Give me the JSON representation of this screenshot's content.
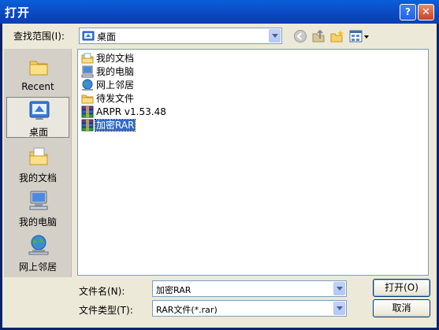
{
  "window": {
    "title": "打开",
    "help_label": "?",
    "close_label": "✕"
  },
  "toolbar": {
    "lookin_label": "查找范围(I):",
    "lookin_value": "桌面",
    "back_icon": "back-icon",
    "up_icon": "up-folder-icon",
    "newfolder_icon": "new-folder-icon",
    "views_icon": "views-menu-icon"
  },
  "places": [
    {
      "label": "Recent",
      "icon": "recent-icon"
    },
    {
      "label": "桌面",
      "icon": "desktop-icon",
      "selected": true
    },
    {
      "label": "我的文档",
      "icon": "my-documents-icon"
    },
    {
      "label": "我的电脑",
      "icon": "my-computer-icon"
    },
    {
      "label": "网上邻居",
      "icon": "network-icon"
    }
  ],
  "files": [
    {
      "label": "我的文档",
      "icon": "documents-folder-icon"
    },
    {
      "label": "我的电脑",
      "icon": "computer-icon"
    },
    {
      "label": "网上邻居",
      "icon": "network-icon"
    },
    {
      "label": "待发文件",
      "icon": "folder-icon"
    },
    {
      "label": "ARPR v1.53.48",
      "icon": "rar-archive-icon"
    },
    {
      "label": "加密RAR",
      "icon": "rar-archive-icon",
      "selected": true
    }
  ],
  "bottom": {
    "filename_label": "文件名(N):",
    "filename_value": "加密RAR",
    "filetype_label": "文件类型(T):",
    "filetype_value": "RAR文件(*.rar)",
    "open_label": "打开(O)",
    "cancel_label": "取消"
  },
  "colors": {
    "title_bar": "#0b4fca",
    "selection": "#316ac5",
    "dialog_face": "#ece9d8"
  }
}
